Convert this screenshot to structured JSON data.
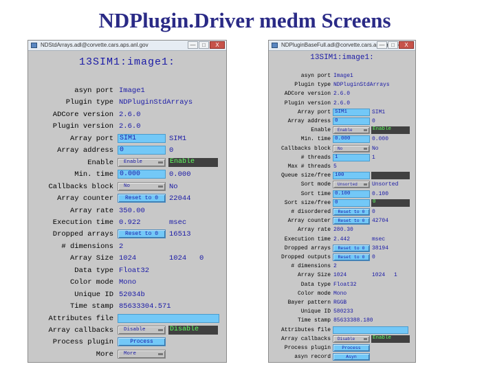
{
  "slide": {
    "title": "NDPlugin.Driver medm Screens"
  },
  "windows": [
    {
      "title": "NDStdArrays.adl@corvette.cars.aps.anl.gov",
      "controls": {
        "min": "—",
        "max": "□",
        "close": "X"
      },
      "header": "13SIM1:image1:",
      "rows": [
        {
          "label": "asyn port",
          "v1": "Image1"
        },
        {
          "label": "Plugin type",
          "v1": "NDPluginStdArrays"
        },
        {
          "label": "ADCore version",
          "v1": "2.6.0"
        },
        {
          "label": "Plugin version",
          "v1": "2.6.0"
        },
        {
          "label": "Array port",
          "input": "SIM1",
          "v2": "SIM1"
        },
        {
          "label": "Array address",
          "input": "0",
          "v2": "0"
        },
        {
          "label": "Enable",
          "menu": "Enable",
          "readback": "Enable"
        },
        {
          "label": "Min. time",
          "input": "0.000",
          "v2": "0.000"
        },
        {
          "label": "Callbacks block",
          "menu": "No",
          "v2": "No"
        },
        {
          "label": "Array counter",
          "button": "Reset to 0",
          "v2": "22044"
        },
        {
          "label": "Array rate",
          "v1": "350.00"
        },
        {
          "label": "Execution time",
          "v1": "0.922",
          "v2": "msec"
        },
        {
          "label": "Dropped arrays",
          "button": "Reset to 0",
          "v2": "16513"
        },
        {
          "label": "# dimensions",
          "v1": "2"
        },
        {
          "label": "Array Size",
          "v1": "1024",
          "v2": "1024",
          "v3": "0"
        },
        {
          "label": "Data type",
          "v1": "Float32"
        },
        {
          "label": "Color mode",
          "v1": "Mono"
        },
        {
          "label": "Unique ID",
          "v1": "52034b"
        },
        {
          "label": "Time stamp",
          "v1": "85633304.571"
        },
        {
          "label": "Attributes file",
          "input_long": ""
        },
        {
          "label": "Array callbacks",
          "menu": "Disable",
          "readback": "Disable"
        },
        {
          "label": "Process plugin",
          "button": "Process"
        },
        {
          "label": "More",
          "menu": "More"
        }
      ]
    },
    {
      "title": "NDPluginBaseFull.adl@corvette.cars.aps.anl.gov",
      "controls": {
        "min": "—",
        "max": "□",
        "close": "X"
      },
      "header": "13SIM1:image1:",
      "rows": [
        {
          "label": "asyn port",
          "v1": "Image1"
        },
        {
          "label": "Plugin type",
          "v1": "NDPluginStdArrays"
        },
        {
          "label": "ADCore version",
          "v1": "2.6.0"
        },
        {
          "label": "Plugin version",
          "v1": "2.6.0"
        },
        {
          "label": "Array port",
          "input": "SIM1",
          "v2": "SIM1"
        },
        {
          "label": "Array address",
          "input": "0",
          "v2": "0"
        },
        {
          "label": "Enable",
          "menu": "Enable",
          "readback": "Enable"
        },
        {
          "label": "Min. time",
          "input": "0.000",
          "v2": "0.000"
        },
        {
          "label": "Callbacks block",
          "menu": "No",
          "v2": "No"
        },
        {
          "label": "# threads",
          "input": "1",
          "v2": "1"
        },
        {
          "label": "Max # threads",
          "v1": "5"
        },
        {
          "label": "Queue size/free",
          "input": "100",
          "readback": ""
        },
        {
          "label": "Sort mode",
          "menu": "Unsorted",
          "v2": "Unsorted"
        },
        {
          "label": "Sort time",
          "input": "0.100",
          "v2": "0.100"
        },
        {
          "label": "Sort size/free",
          "input": "0",
          "readback": "0"
        },
        {
          "label": "# disordered",
          "button": "Reset to 0",
          "v2": "0"
        },
        {
          "label": "Array counter",
          "button": "Reset to 0",
          "v2": "42704"
        },
        {
          "label": "Array rate",
          "v1": "280.30"
        },
        {
          "label": "Execution time",
          "v1": "2.442",
          "v2": "msec"
        },
        {
          "label": "Dropped arrays",
          "button": "Reset to 0",
          "v2": "38194"
        },
        {
          "label": "Dropped outputs",
          "button": "Reset to 0",
          "v2": "0"
        },
        {
          "label": "# dimensions",
          "v1": "2"
        },
        {
          "label": "Array Size",
          "v1": "1024",
          "v2": "1024",
          "v3": "1"
        },
        {
          "label": "Data type",
          "v1": "Float32"
        },
        {
          "label": "Color mode",
          "v1": "Mono"
        },
        {
          "label": "Bayer pattern",
          "v1": "RGGB"
        },
        {
          "label": "Unique ID",
          "v1": "580233"
        },
        {
          "label": "Time stamp",
          "v1": "85633388.180"
        },
        {
          "label": "Attributes file",
          "input_long": ""
        },
        {
          "label": "Array callbacks",
          "menu": "Disable",
          "readback": "Enable"
        },
        {
          "label": "Process plugin",
          "button": "Process"
        },
        {
          "label": "asyn record",
          "button": "Asyn"
        }
      ]
    }
  ]
}
